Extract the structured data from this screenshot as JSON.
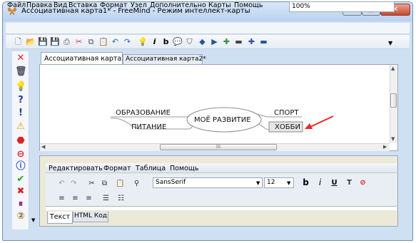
{
  "window": {
    "title": "Ассоциативная карта1* - FreeMind - Режим интеллект-карты",
    "min_label": "—",
    "max_label": "□",
    "close_label": "✕"
  },
  "menubar": {
    "items": [
      "Файл",
      "Правка",
      "Вид",
      "Вставка",
      "Формат",
      "Узел",
      "Дополнительно",
      "Карты",
      "Помощь"
    ]
  },
  "toolbar": {
    "zoom_value": "100%",
    "icons": [
      "new-file-icon",
      "open-folder-icon",
      "save-icon",
      "save-as-icon",
      "print-icon",
      "cut-icon",
      "copy-icon",
      "paste-icon",
      "undo-icon",
      "redo-icon",
      "bulb-icon",
      "italic-icon",
      "bold-icon",
      "speech-bubble-icon",
      "filter-icon",
      "arrow-left-icon",
      "arrow-right-icon",
      "add-node-icon",
      "remove-icon",
      "zoom-in-icon",
      "zoom-out-icon"
    ]
  },
  "left_toolbar": {
    "icons": [
      "delete-x-icon",
      "trash-icon",
      "bulb-icon",
      "question-icon",
      "exclamation-icon",
      "warning-icon",
      "stop-icon",
      "minus-circle-icon",
      "info-icon",
      "checkmark-icon",
      "red-x-icon",
      "pause-icon",
      "number-two-icon"
    ]
  },
  "tabs": [
    {
      "label": "Ассоциативная карта1*",
      "active": true
    },
    {
      "label": "Ассоциативная карта2*",
      "active": false
    }
  ],
  "mindmap": {
    "root": "МОЁ РАЗВИТИЕ",
    "left_nodes": [
      "ОБРАЗОВАНИЕ",
      "ПИТАНИЕ"
    ],
    "right_nodes": [
      "СПОРТ",
      "ХОББИ"
    ],
    "selected_node": "ХОББИ",
    "arrow_color": "#e8282b",
    "edge_color": "#9a9a9a",
    "scroll_grip": "III"
  },
  "editor": {
    "menu": [
      "Редактировать",
      "Формат",
      "Таблица",
      "Помощь"
    ],
    "font_value": "SansSerif",
    "size_value": "12",
    "tabs": [
      {
        "label": "Текст",
        "active": true
      },
      {
        "label": "HTML Код",
        "active": false
      }
    ]
  },
  "colors": {
    "frame": "#cfe0f3",
    "close_button": "#c6492f",
    "selected_node_bg": "#e6e6e6"
  }
}
